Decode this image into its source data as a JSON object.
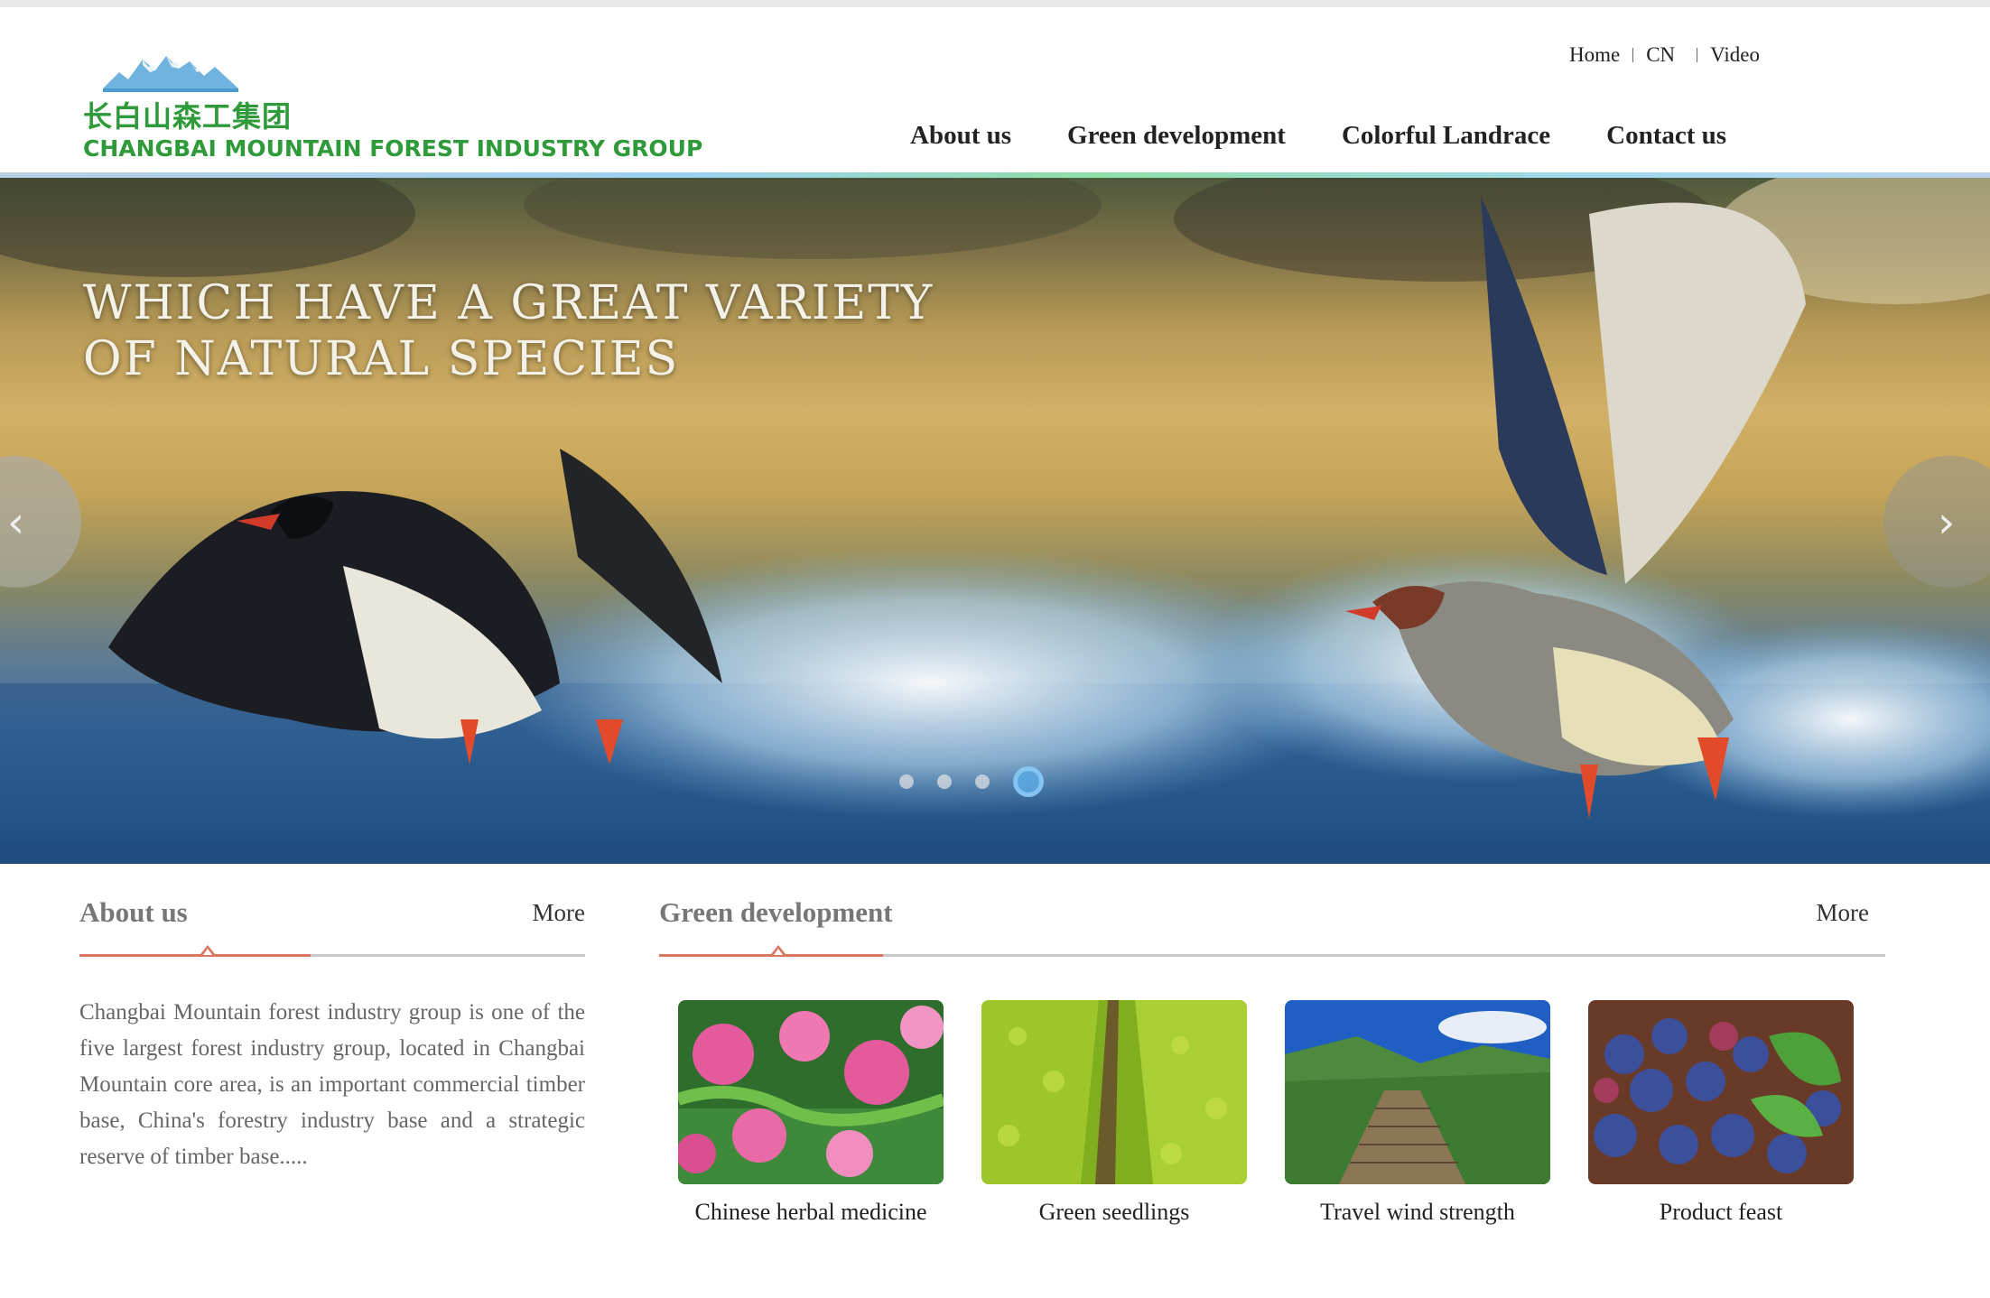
{
  "header": {
    "logo_cn": "长白山森工集团",
    "logo_en": "CHANGBAI MOUNTAIN FOREST INDUSTRY GROUP",
    "top_links": [
      "Home",
      "CN",
      "Video"
    ],
    "nav": [
      "About us",
      "Green development",
      "Colorful Landrace",
      "Contact us"
    ]
  },
  "banner": {
    "caption_line1": "WHICH HAVE A GREAT VARIETY",
    "caption_line2": "OF NATURAL SPECIES",
    "slide_count": 4,
    "active_slide": 4,
    "prev_icon": "chevron-left-icon",
    "next_icon": "chevron-right-icon"
  },
  "about": {
    "title": "About us",
    "more": "More",
    "text": "Changbai Mountain forest industry group is one of the five largest forest industry group, located in Changbai Mountain core area, is an important commercial timber base, China's forestry industry base and a strategic reserve of timber base....."
  },
  "green": {
    "title": "Green development",
    "more": "More",
    "cards": [
      {
        "label": "Chinese herbal medicine"
      },
      {
        "label": "Green seedlings"
      },
      {
        "label": "Travel wind strength"
      },
      {
        "label": "Product feast"
      }
    ]
  },
  "colors": {
    "brand_green": "#2e9a3a",
    "accent": "#d9775e",
    "dot_active": "#5aaae6"
  }
}
